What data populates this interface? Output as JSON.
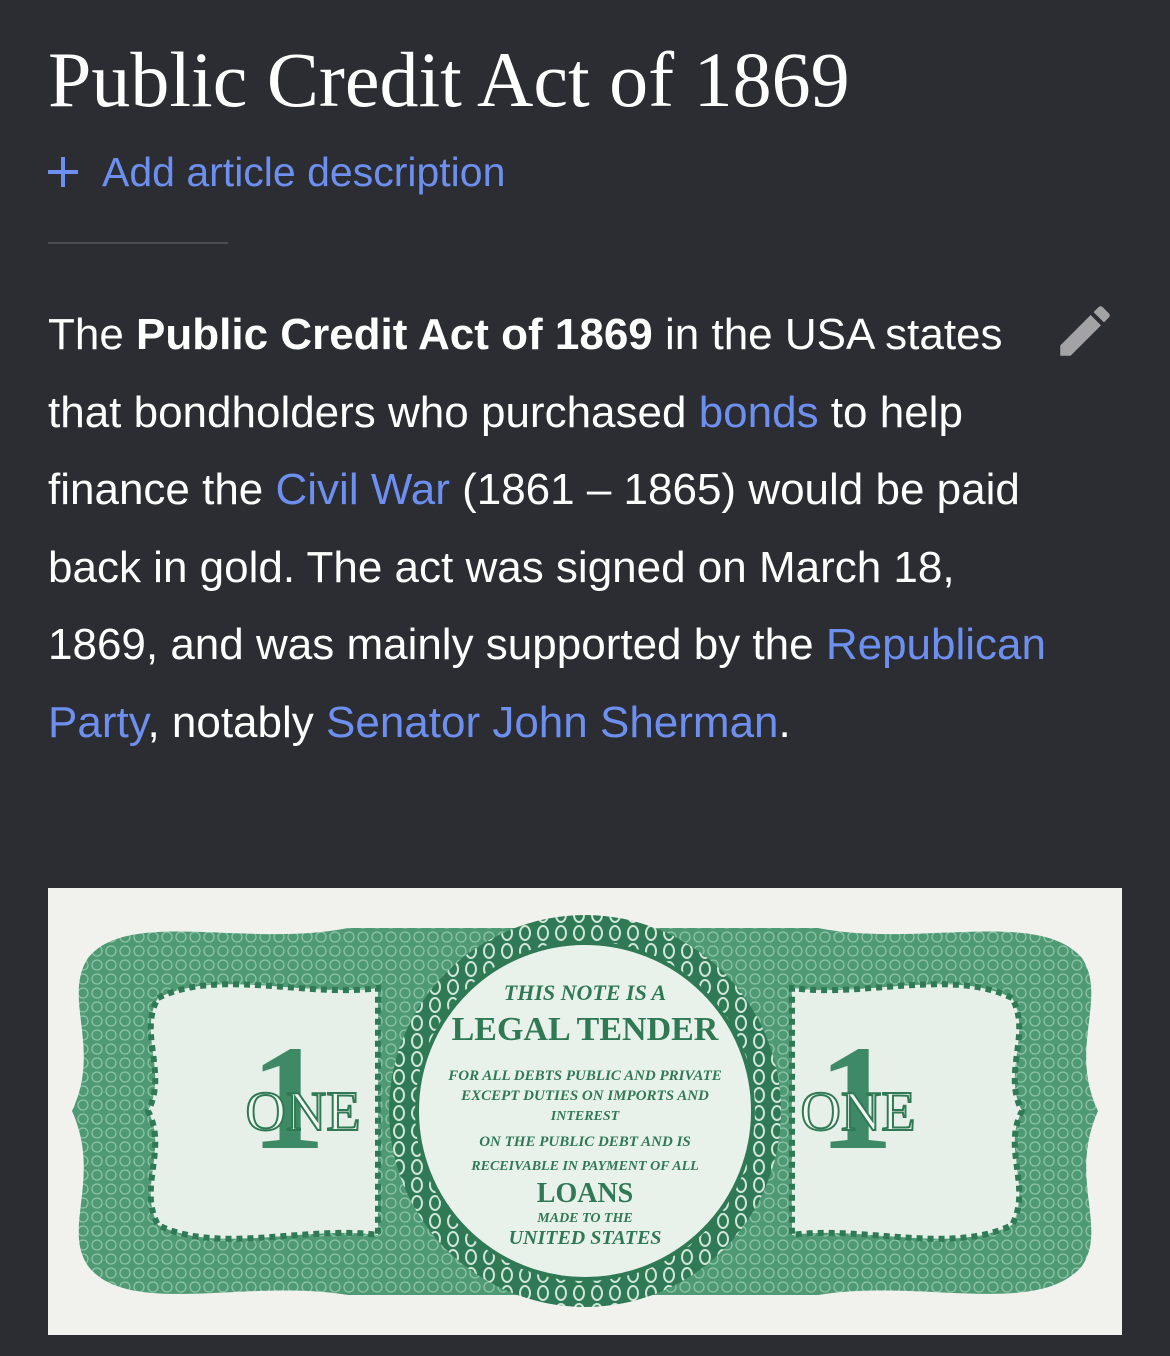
{
  "article": {
    "title": "Public Credit Act of 1869",
    "add_description_label": "Add article description",
    "paragraph": {
      "t1": "The ",
      "bold": "Public Credit Act of 1869",
      "t2": " in the USA states that bondholders who purchased ",
      "link_bonds": "bonds",
      "t3": " to help finance the ",
      "link_civil_war": "Civil War",
      "t4": " (1861 – 1865) would be paid back in gold. The act was signed on March 18, 1869, and was mainly supported by the ",
      "link_republican": "Republican Party",
      "t5": ", notably ",
      "link_sherman": "Senator John Sherman",
      "t6": "."
    }
  },
  "icons": {
    "add": "plus-icon",
    "edit": "pencil-icon"
  },
  "banknote": {
    "left_denomination": "ONE",
    "right_denomination": "ONE",
    "numeral": "1",
    "seal_lines": [
      "THIS NOTE IS A",
      "LEGAL TENDER",
      "FOR ALL DEBTS PUBLIC AND PRIVATE",
      "EXCEPT DUTIES ON IMPORTS AND",
      "INTEREST",
      "ON THE PUBLIC DEBT AND IS",
      "RECEIVABLE IN PAYMENT OF ALL",
      "LOANS",
      "MADE TO THE",
      "UNITED STATES"
    ]
  },
  "colors": {
    "background": "#2b2d32",
    "text": "#ffffff",
    "link": "#6d8ff0",
    "note_green": "#3f8a66",
    "note_paper": "#f1f2ee"
  }
}
